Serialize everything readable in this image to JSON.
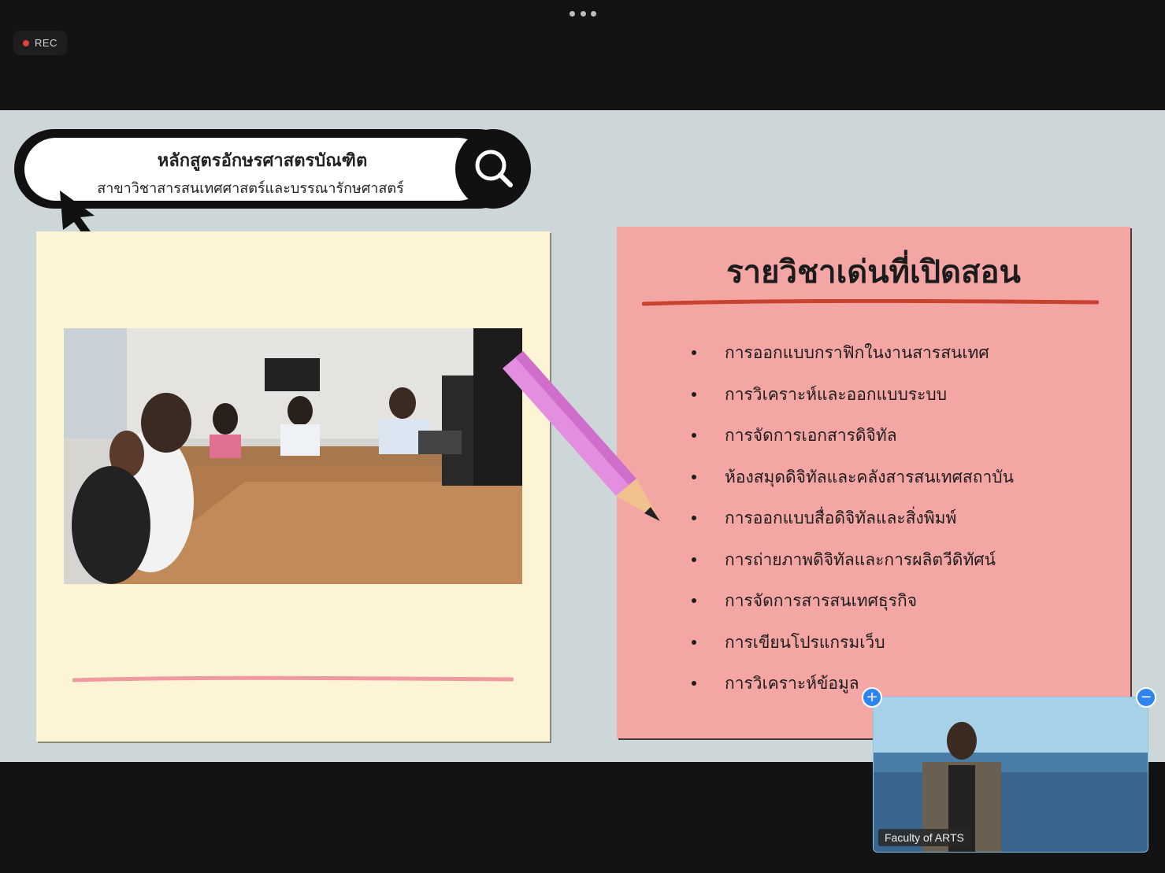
{
  "topbar": {
    "more_icon": "more-horizontal-icon",
    "rec_label": "REC"
  },
  "slide": {
    "search": {
      "line1": "หลักสูตรอักษรศาสตรบัณฑิต",
      "line2": "สาขาวิชาสารสนเทศศาสตร์และบรรณารักษศาสตร์",
      "icon": "search-icon"
    },
    "pink_note": {
      "title": "รายวิชาเด่นที่เปิดสอน",
      "courses": [
        "การออกแบบกราฟิกในงานสารสนเทศ",
        "การวิเคราะห์และออกแบบระบบ",
        "การจัดการเอกสารดิจิทัล",
        "ห้องสมุดดิจิทัลและคลังสารสนเทศสถาบัน",
        "การออกแบบสื่อดิจิทัลและสิ่งพิมพ์",
        "การถ่ายภาพดิจิทัลและการผลิตวีดิทัศน์",
        "การจัดการสารสนเทศธุรกิจ",
        "การเขียนโปรแกรมเว็บ",
        "การวิเคราะห์ข้อมูล"
      ]
    },
    "colors": {
      "slide_bg": "#cdd6d8",
      "yellow_note": "#fdf4d6",
      "pink_note": "#f4a6a4",
      "underline_red": "#c8432f",
      "pencil": "#e48ee0"
    }
  },
  "camera": {
    "name": "Faculty of ARTS",
    "add_icon": "plus-icon",
    "remove_icon": "minus-icon"
  }
}
